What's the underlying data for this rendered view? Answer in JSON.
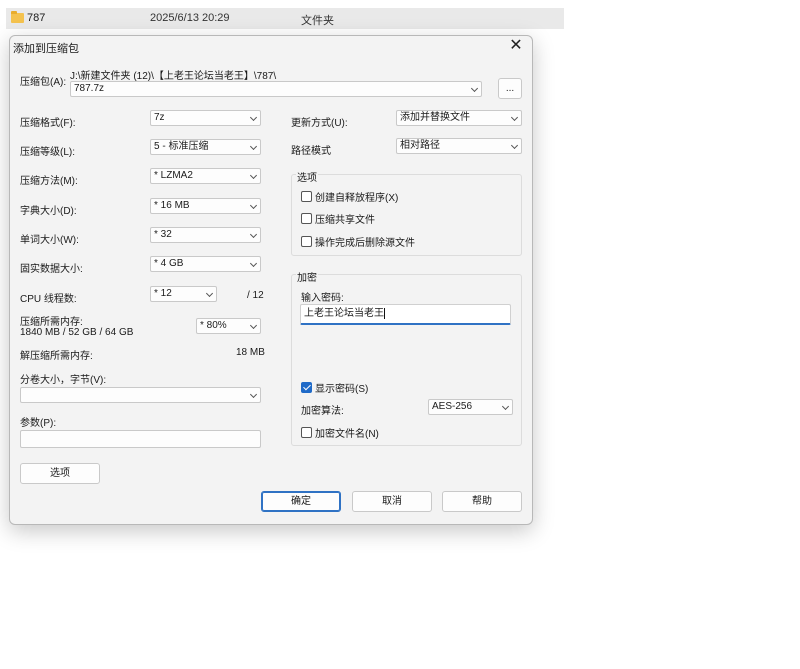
{
  "file_row": {
    "name": "787",
    "date": "2025/6/13 20:29",
    "type": "文件夹"
  },
  "dialog": {
    "title": "添加到压缩包",
    "archive": {
      "label": "压缩包(A):",
      "path": "J:\\新建文件夹 (12)\\【上老王论坛当老王】\\787\\",
      "value": "787.7z",
      "browse_label": "..."
    },
    "left": {
      "format": {
        "label": "压缩格式(F):",
        "value": "7z"
      },
      "level": {
        "label": "压缩等级(L):",
        "value": "5 - 标准压缩"
      },
      "method": {
        "label": "压缩方法(M):",
        "value": "* LZMA2"
      },
      "dict": {
        "label": "字典大小(D):",
        "value": "* 16 MB"
      },
      "word": {
        "label": "单词大小(W):",
        "value": "* 32"
      },
      "solid": {
        "label": "固实数据大小:",
        "value": "* 4 GB"
      },
      "threads": {
        "label": "CPU 线程数:",
        "value": "* 12",
        "max": "/ 12"
      },
      "mem_compress": {
        "label": "压缩所需内存:",
        "detail": "1840 MB / 52 GB / 64 GB",
        "value": "* 80%"
      },
      "mem_decompress": {
        "label": "解压缩所需内存:",
        "value": "18 MB"
      },
      "split": {
        "label": "分卷大小，字节(V):",
        "value": ""
      },
      "params": {
        "label": "参数(P):",
        "value": ""
      },
      "options_button": "选项"
    },
    "right": {
      "update": {
        "label": "更新方式(U):",
        "value": "添加并替换文件"
      },
      "path_mode": {
        "label": "路径模式",
        "value": "相对路径"
      },
      "options_group": {
        "title": "选项",
        "items": [
          {
            "label": "创建自释放程序(X)",
            "checked": false
          },
          {
            "label": "压缩共享文件",
            "checked": false
          },
          {
            "label": "操作完成后删除源文件",
            "checked": false
          }
        ]
      },
      "encryption": {
        "title": "加密",
        "password_label": "输入密码:",
        "password_value": "上老王论坛当老王",
        "show_password": {
          "label": "显示密码(S)",
          "checked": true
        },
        "method_label": "加密算法:",
        "method_value": "AES-256",
        "encrypt_names": {
          "label": "加密文件名(N)",
          "checked": false
        }
      }
    },
    "buttons": {
      "ok": "确定",
      "cancel": "取消",
      "help": "帮助"
    }
  },
  "colors": {
    "accent": "#2f72c4",
    "checkbox_checked": "#1f6ac8",
    "folder": "#f4c24e"
  }
}
